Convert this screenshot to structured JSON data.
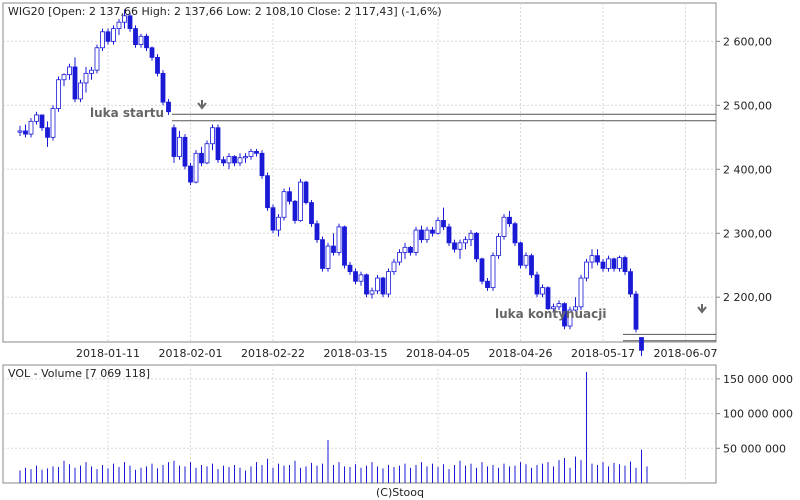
{
  "price_header": "WIG20 [Open: 2 137,66  High: 2 137,66  Low: 2 108,10  Close: 2 117,43] (-1,6%)",
  "volume_header": "VOL - Volume [7 069 118]",
  "footer": "(C)Stooq",
  "annotations": {
    "start_gap": "luka startu",
    "continuation_gap": "luka kontynuacji"
  },
  "colors": {
    "up_candle": "#ffffff",
    "down_candle": "#1a1ad6",
    "candle_outline": "#1a1ad6",
    "volume_bar": "#1a1ad6",
    "gap_line": "#555555"
  },
  "chart_data": [
    {
      "type": "candlestick",
      "title": "WIG20",
      "ylim": [
        2130,
        2660
      ],
      "y_ticks": [
        "2 200,00",
        "2 300,00",
        "2 400,00",
        "2 500,00",
        "2 600,00"
      ],
      "y_tick_values": [
        2200,
        2300,
        2400,
        2500,
        2600
      ],
      "x_ticks": [
        "2018-01-11",
        "2018-02-01",
        "2018-02-22",
        "2018-03-15",
        "2018-04-05",
        "2018-04-26",
        "2018-05-17",
        "2018-06-07"
      ],
      "x_tick_index": [
        16,
        31,
        46,
        61,
        76,
        91,
        106,
        121
      ],
      "grid": true,
      "gap_levels": {
        "start_gap": [
          2476,
          2486
        ],
        "continuation_gap": [
          2132,
          2142
        ]
      },
      "ohlc": [
        [
          2458,
          2468,
          2452,
          2460
        ],
        [
          2460,
          2470,
          2450,
          2455
        ],
        [
          2455,
          2480,
          2450,
          2475
        ],
        [
          2475,
          2490,
          2470,
          2485
        ],
        [
          2485,
          2485,
          2460,
          2465
        ],
        [
          2465,
          2475,
          2435,
          2450
        ],
        [
          2450,
          2500,
          2445,
          2495
        ],
        [
          2495,
          2545,
          2490,
          2540
        ],
        [
          2540,
          2550,
          2530,
          2548
        ],
        [
          2548,
          2565,
          2540,
          2560
        ],
        [
          2560,
          2575,
          2505,
          2510
        ],
        [
          2510,
          2540,
          2505,
          2535
        ],
        [
          2535,
          2560,
          2520,
          2550
        ],
        [
          2550,
          2560,
          2540,
          2555
        ],
        [
          2555,
          2595,
          2550,
          2590
        ],
        [
          2590,
          2620,
          2585,
          2615
        ],
        [
          2615,
          2620,
          2595,
          2600
        ],
        [
          2600,
          2625,
          2595,
          2620
        ],
        [
          2620,
          2635,
          2610,
          2630
        ],
        [
          2630,
          2650,
          2620,
          2640
        ],
        [
          2640,
          2645,
          2615,
          2620
        ],
        [
          2620,
          2625,
          2590,
          2595
        ],
        [
          2595,
          2612,
          2590,
          2608
        ],
        [
          2608,
          2612,
          2585,
          2590
        ],
        [
          2590,
          2592,
          2570,
          2575
        ],
        [
          2575,
          2580,
          2545,
          2550
        ],
        [
          2550,
          2555,
          2500,
          2505
        ],
        [
          2505,
          2510,
          2485,
          2490
        ],
        [
          2465,
          2470,
          2410,
          2420
        ],
        [
          2420,
          2460,
          2415,
          2450
        ],
        [
          2450,
          2455,
          2400,
          2405
        ],
        [
          2405,
          2410,
          2375,
          2380
        ],
        [
          2380,
          2430,
          2378,
          2425
        ],
        [
          2425,
          2435,
          2405,
          2410
        ],
        [
          2410,
          2445,
          2408,
          2440
        ],
        [
          2440,
          2470,
          2430,
          2465
        ],
        [
          2465,
          2470,
          2410,
          2415
        ],
        [
          2415,
          2420,
          2405,
          2410
        ],
        [
          2410,
          2425,
          2400,
          2420
        ],
        [
          2420,
          2422,
          2405,
          2410
        ],
        [
          2410,
          2425,
          2405,
          2418
        ],
        [
          2418,
          2425,
          2410,
          2420
        ],
        [
          2420,
          2432,
          2415,
          2428
        ],
        [
          2428,
          2432,
          2420,
          2425
        ],
        [
          2425,
          2430,
          2385,
          2390
        ],
        [
          2390,
          2395,
          2335,
          2340
        ],
        [
          2340,
          2345,
          2300,
          2305
        ],
        [
          2305,
          2330,
          2295,
          2325
        ],
        [
          2325,
          2370,
          2320,
          2365
        ],
        [
          2365,
          2372,
          2345,
          2350
        ],
        [
          2350,
          2352,
          2315,
          2320
        ],
        [
          2320,
          2385,
          2318,
          2380
        ],
        [
          2380,
          2382,
          2345,
          2348
        ],
        [
          2348,
          2352,
          2310,
          2315
        ],
        [
          2315,
          2320,
          2285,
          2290
        ],
        [
          2290,
          2295,
          2240,
          2245
        ],
        [
          2245,
          2285,
          2240,
          2280
        ],
        [
          2280,
          2300,
          2265,
          2270
        ],
        [
          2270,
          2315,
          2265,
          2310
        ],
        [
          2310,
          2312,
          2245,
          2250
        ],
        [
          2250,
          2255,
          2235,
          2240
        ],
        [
          2240,
          2245,
          2220,
          2225
        ],
        [
          2225,
          2240,
          2218,
          2235
        ],
        [
          2235,
          2237,
          2200,
          2205
        ],
        [
          2205,
          2215,
          2198,
          2210
        ],
        [
          2210,
          2235,
          2205,
          2230
        ],
        [
          2230,
          2232,
          2200,
          2205
        ],
        [
          2205,
          2245,
          2200,
          2240
        ],
        [
          2240,
          2260,
          2235,
          2255
        ],
        [
          2255,
          2275,
          2250,
          2270
        ],
        [
          2270,
          2285,
          2260,
          2278
        ],
        [
          2278,
          2280,
          2265,
          2270
        ],
        [
          2270,
          2310,
          2265,
          2305
        ],
        [
          2305,
          2312,
          2285,
          2290
        ],
        [
          2290,
          2310,
          2285,
          2305
        ],
        [
          2305,
          2310,
          2295,
          2300
        ],
        [
          2300,
          2325,
          2298,
          2320
        ],
        [
          2320,
          2340,
          2305,
          2310
        ],
        [
          2310,
          2315,
          2280,
          2285
        ],
        [
          2285,
          2290,
          2270,
          2275
        ],
        [
          2275,
          2290,
          2260,
          2285
        ],
        [
          2285,
          2295,
          2275,
          2290
        ],
        [
          2290,
          2305,
          2280,
          2300
        ],
        [
          2300,
          2302,
          2255,
          2260
        ],
        [
          2260,
          2262,
          2220,
          2225
        ],
        [
          2225,
          2230,
          2210,
          2215
        ],
        [
          2215,
          2270,
          2210,
          2265
        ],
        [
          2265,
          2300,
          2260,
          2295
        ],
        [
          2295,
          2330,
          2290,
          2325
        ],
        [
          2325,
          2335,
          2310,
          2315
        ],
        [
          2315,
          2318,
          2280,
          2285
        ],
        [
          2285,
          2287,
          2245,
          2250
        ],
        [
          2250,
          2270,
          2245,
          2265
        ],
        [
          2265,
          2268,
          2230,
          2235
        ],
        [
          2235,
          2240,
          2200,
          2205
        ],
        [
          2205,
          2220,
          2200,
          2215
        ],
        [
          2215,
          2217,
          2180,
          2182
        ],
        [
          2182,
          2190,
          2178,
          2185
        ],
        [
          2185,
          2195,
          2180,
          2190
        ],
        [
          2190,
          2192,
          2150,
          2155
        ],
        [
          2155,
          2185,
          2150,
          2180
        ],
        [
          2180,
          2200,
          2178,
          2185
        ],
        [
          2185,
          2235,
          2180,
          2230
        ],
        [
          2230,
          2260,
          2225,
          2255
        ],
        [
          2255,
          2275,
          2245,
          2265
        ],
        [
          2265,
          2275,
          2250,
          2255
        ],
        [
          2255,
          2260,
          2240,
          2245
        ],
        [
          2245,
          2265,
          2240,
          2260
        ],
        [
          2260,
          2262,
          2240,
          2245
        ],
        [
          2245,
          2265,
          2240,
          2262
        ],
        [
          2262,
          2265,
          2235,
          2240
        ],
        [
          2240,
          2245,
          2200,
          2205
        ],
        [
          2205,
          2210,
          2145,
          2150
        ],
        [
          2137,
          2137,
          2108,
          2117
        ]
      ]
    },
    {
      "type": "bar",
      "title": "VOL - Volume",
      "ylim": [
        0,
        170000000
      ],
      "y_ticks": [
        "50 000 000",
        "100 000 000",
        "150 000 000"
      ],
      "y_tick_values": [
        50000000,
        100000000,
        150000000
      ],
      "values": [
        18000000,
        22000000,
        20000000,
        25000000,
        19000000,
        21000000,
        24000000,
        23000000,
        32000000,
        27000000,
        22000000,
        25000000,
        30000000,
        24000000,
        20000000,
        26000000,
        21000000,
        28000000,
        23000000,
        30000000,
        25000000,
        19000000,
        22000000,
        24000000,
        28000000,
        21000000,
        26000000,
        30000000,
        32000000,
        25000000,
        24000000,
        30000000,
        22000000,
        26000000,
        24000000,
        28000000,
        20000000,
        25000000,
        23000000,
        26000000,
        22000000,
        18000000,
        24000000,
        30000000,
        26000000,
        35000000,
        22000000,
        28000000,
        25000000,
        26000000,
        32000000,
        22000000,
        24000000,
        29000000,
        25000000,
        28000000,
        62000000,
        26000000,
        30000000,
        24000000,
        23000000,
        27000000,
        22000000,
        25000000,
        30000000,
        24000000,
        21000000,
        26000000,
        23000000,
        25000000,
        28000000,
        22000000,
        26000000,
        30000000,
        24000000,
        28000000,
        23000000,
        27000000,
        20000000,
        26000000,
        32000000,
        25000000,
        28000000,
        22000000,
        30000000,
        24000000,
        26000000,
        22000000,
        28000000,
        24000000,
        25000000,
        30000000,
        27000000,
        22000000,
        26000000,
        28000000,
        30000000,
        24000000,
        33000000,
        36000000,
        22000000,
        38000000,
        33000000,
        160000000,
        28000000,
        26000000,
        30000000,
        24000000,
        29000000,
        27000000,
        25000000,
        31000000,
        22000000,
        48000000,
        24000000
      ]
    }
  ]
}
